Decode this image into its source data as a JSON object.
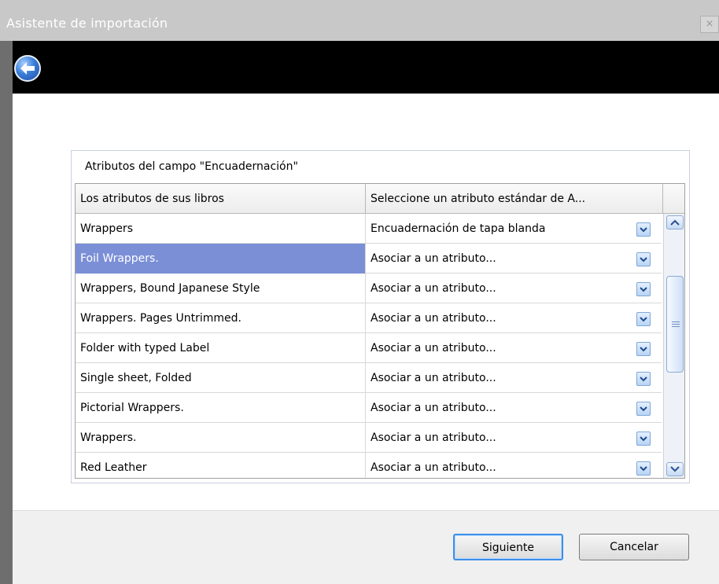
{
  "window": {
    "title": "Asistente de importación",
    "close_label": "×"
  },
  "groupbox": {
    "title": "Atributos del campo \"Encuadernación\""
  },
  "table": {
    "columns": [
      "Los atributos de sus libros",
      "Seleccione un atributo estándar de A..."
    ],
    "rows": [
      {
        "attribute": "Wrappers",
        "mapping": "Encuadernación de tapa blanda",
        "selected": false
      },
      {
        "attribute": "Foil Wrappers.",
        "mapping": "Asociar a un atributo...",
        "selected": true
      },
      {
        "attribute": "Wrappers, Bound Japanese Style",
        "mapping": "Asociar a un atributo...",
        "selected": false
      },
      {
        "attribute": "Wrappers. Pages Untrimmed.",
        "mapping": "Asociar a un atributo...",
        "selected": false
      },
      {
        "attribute": "Folder with typed Label",
        "mapping": "Asociar a un atributo...",
        "selected": false
      },
      {
        "attribute": "Single sheet, Folded",
        "mapping": "Asociar a un atributo...",
        "selected": false
      },
      {
        "attribute": "Pictorial Wrappers.",
        "mapping": "Asociar a un atributo...",
        "selected": false
      },
      {
        "attribute": "Wrappers.",
        "mapping": "Asociar a un atributo...",
        "selected": false
      },
      {
        "attribute": "Red Leather",
        "mapping": "Asociar a un atributo...",
        "selected": false
      }
    ]
  },
  "buttons": {
    "next": "Siguiente",
    "cancel": "Cancelar"
  },
  "colors": {
    "selection": "#7b8fd6",
    "header_bar": "#000000",
    "accent": "#3d8ee6"
  }
}
